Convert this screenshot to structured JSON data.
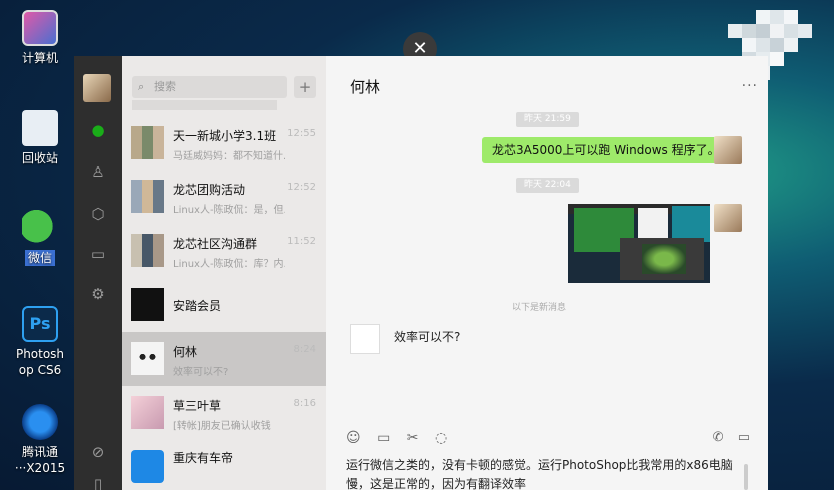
{
  "desktop": {
    "icons": [
      {
        "label": "计算机"
      },
      {
        "label": "回收站"
      },
      {
        "label": "微信"
      },
      {
        "label": "Photosh op CS6"
      },
      {
        "label": "腾讯通 ···X2015"
      }
    ]
  },
  "close_glyph": "✕",
  "sidebar": {
    "search_placeholder": "搜索",
    "add_label": "+"
  },
  "conversations": [
    {
      "name": "天一新城小学3.1班",
      "preview": "马廷威妈妈：都不知道什...",
      "time": "12:55"
    },
    {
      "name": "龙芯团购活动",
      "preview": "Linux人-陈政侃：是，但...",
      "time": "12:52"
    },
    {
      "name": "龙芯社区沟通群",
      "preview": "Linux人-陈政侃：库？内...",
      "time": "11:52"
    },
    {
      "name": "安踏会员",
      "preview": "",
      "time": ""
    },
    {
      "name": "何林",
      "preview": "效率可以不?",
      "time": "8:24"
    },
    {
      "name": "草三叶草",
      "preview": "[转帐]朋友已确认收钱",
      "time": "8:16"
    },
    {
      "name": "重庆有车帝",
      "preview": "",
      "time": ""
    }
  ],
  "chat": {
    "title": "何林",
    "more": "···",
    "time1": "昨天 21:59",
    "msg1": "龙芯3A5000上可以跑 Windows 程序了。",
    "time2": "昨天 22:04",
    "divider_note": "以下是新消息",
    "msg2": "效率可以不?",
    "input_text": "运行微信之类的，没有卡顿的感觉。运行PhotoShop比我常用的x86电脑慢，这是正常的，因为有翻译效率"
  },
  "colors": {
    "bubble_me": "#9eea6a",
    "rail": "#2e2e2e",
    "list_bg": "#ebe9e8",
    "active_row": "#c9c7c6"
  }
}
